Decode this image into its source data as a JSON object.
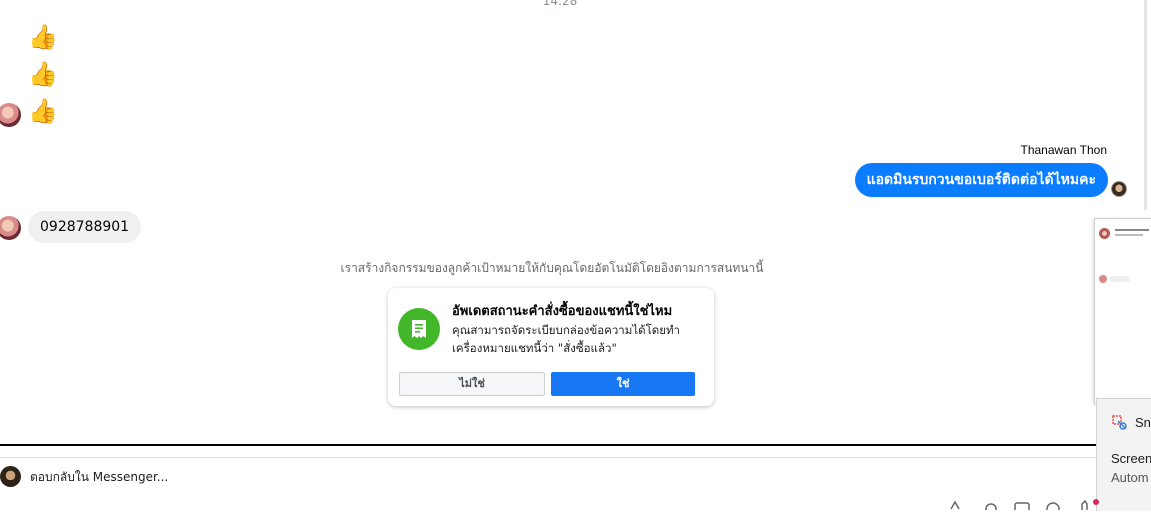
{
  "chat": {
    "timestamp": "14:28",
    "reactions": [
      "👍",
      "👍",
      "👍"
    ],
    "sender_name": "Thanawan Thon",
    "outgoing_message": "แอดมินรบกวนขอเบอร์ติดต่อได้ไหมคะ",
    "incoming_message": "0928788901",
    "system_note": "เราสร้างกิจกรรมของลูกค้าเป้าหมายให้กับคุณโดยอัตโนมัติโดยอิงตามการสนทนานี้"
  },
  "order_card": {
    "title": "อัพเดตสถานะคำสั่งซื้อของแชทนี้ใช่ไหม",
    "body_line1": "คุณสามารถจัดระเบียบกล่องข้อความได้โดยทำ",
    "body_line2": "เครื่องหมายแชทนี้ว่า \"สั่งซื้อแล้ว\"",
    "no_label": "ไม่ใช่",
    "yes_label": "ใช่"
  },
  "composer": {
    "placeholder": "ตอบกลับใน Messenger..."
  },
  "side_panel": {
    "snip_label": "Sni",
    "screen_label": "Screen",
    "auto_label": "Autom"
  },
  "colors": {
    "outgoing_bubble": "#0a7cff",
    "primary_button": "#1877f2",
    "order_icon": "#42b72a"
  }
}
